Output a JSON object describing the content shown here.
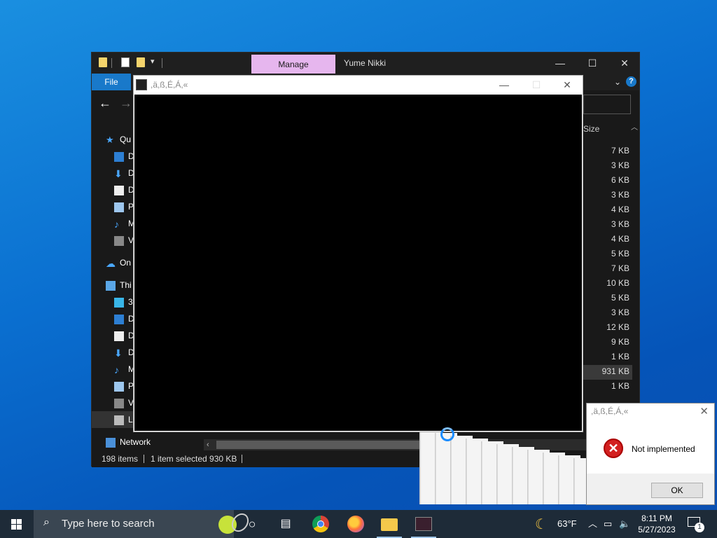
{
  "explorer": {
    "manage_tab": "Manage",
    "title": "Yume Nikki",
    "file_tab": "File",
    "nav": {
      "quick_access": "Qu",
      "desktop": "D",
      "downloads": "D",
      "documents": "D",
      "pictures": "P",
      "music": "M",
      "videos": "V",
      "onedrive": "On",
      "this_pc": "Thi",
      "objects3d": "3",
      "pc_desktop": "D",
      "pc_documents": "D",
      "pc_downloads": "D",
      "pc_music": "M",
      "pc_pictures": "P",
      "pc_videos": "V",
      "local_disk": "L",
      "network": "Network"
    },
    "size_header": "Size",
    "sizes": [
      "7 KB",
      "3 KB",
      "6 KB",
      "3 KB",
      "4 KB",
      "3 KB",
      "4 KB",
      "5 KB",
      "7 KB",
      "10 KB",
      "5 KB",
      "3 KB",
      "12 KB",
      "9 KB",
      "1 KB",
      "931 KB",
      "1 KB"
    ],
    "status": {
      "items": "198 items",
      "selected": "1 item selected  930 KB"
    }
  },
  "game": {
    "title": ",ä,ß,É,Á,«"
  },
  "dialog": {
    "title": ",ä,ß,É,Á,«",
    "message": "Not implemented",
    "ok_label": "OK"
  },
  "taskbar": {
    "search_placeholder": "Type here to search",
    "weather_temp": "63°F",
    "time": "8:11 PM",
    "date": "5/27/2023",
    "notification_count": "1"
  },
  "colors": {
    "manage_tab": "#e6b6ee",
    "file_tab": "#1979ca",
    "error_red": "#d32020",
    "taskbar": "#1e2b38"
  }
}
